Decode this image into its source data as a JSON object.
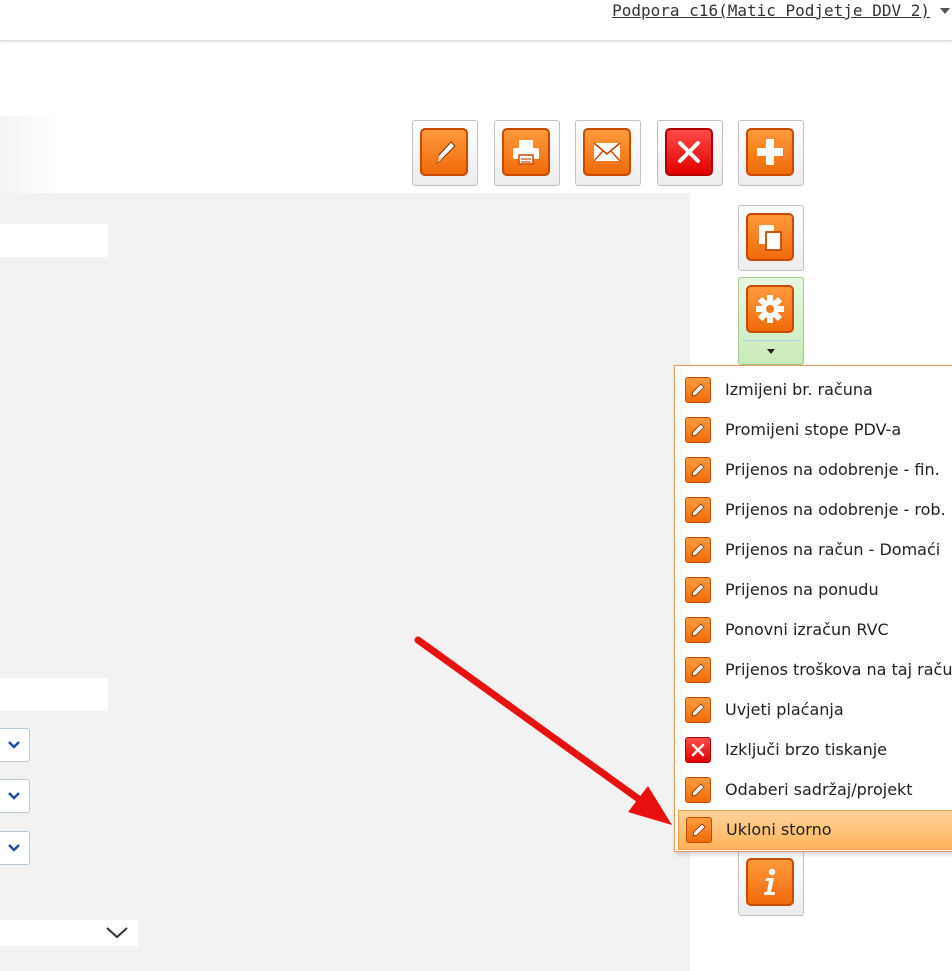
{
  "header": {
    "user_label": "Podpora c16(Matic Podjetje DDV 2)",
    "caret_icon": "chevron-down-icon"
  },
  "toolbar": {
    "buttons": [
      {
        "name": "edit-button",
        "icon": "pencil-icon"
      },
      {
        "name": "print-button",
        "icon": "printer-icon"
      },
      {
        "name": "email-button",
        "icon": "envelope-icon"
      },
      {
        "name": "delete-button",
        "icon": "close-icon"
      },
      {
        "name": "add-button",
        "icon": "plus-icon"
      },
      {
        "name": "copy-button",
        "icon": "copy-icon"
      },
      {
        "name": "settings-button",
        "icon": "gear-icon"
      },
      {
        "name": "info-button",
        "icon": "info-icon"
      }
    ]
  },
  "menu": {
    "items": [
      {
        "label": "Izmijeni br. računa",
        "icon": "pencil-icon"
      },
      {
        "label": "Promijeni stope PDV-a",
        "icon": "pencil-icon"
      },
      {
        "label": "Prijenos na odobrenje - fin.",
        "icon": "pencil-icon"
      },
      {
        "label": "Prijenos na odobrenje - rob.",
        "icon": "pencil-icon"
      },
      {
        "label": "Prijenos na račun - Domaći",
        "icon": "pencil-icon"
      },
      {
        "label": "Prijenos na ponudu",
        "icon": "pencil-icon"
      },
      {
        "label": "Ponovni izračun RVC",
        "icon": "pencil-icon"
      },
      {
        "label": "Prijenos troškova na taj raču",
        "icon": "pencil-icon"
      },
      {
        "label": "Uvjeti plaćanja",
        "icon": "pencil-icon"
      },
      {
        "label": "Izključi brzo tiskanje",
        "icon": "close-icon"
      },
      {
        "label": "Odaberi sadržaj/projekt",
        "icon": "pencil-icon"
      },
      {
        "label": "Ukloni storno",
        "icon": "pencil-icon",
        "active": true
      }
    ]
  },
  "colors": {
    "accent_orange": "#f27a12",
    "delete_red": "#e00000",
    "arrow_red": "#e81010",
    "highlight": "#ffb25a"
  }
}
